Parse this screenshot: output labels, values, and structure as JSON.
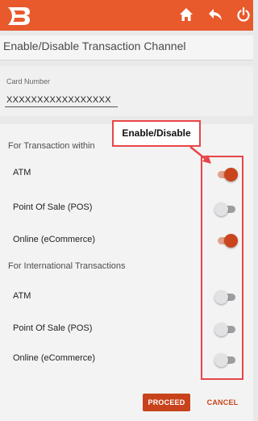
{
  "header": {
    "logo_icon": "bank-of-baroda-logo",
    "icons": [
      "home-icon",
      "back-icon",
      "power-icon"
    ],
    "brand_color": "#e8592c"
  },
  "page": {
    "title": "Enable/Disable Transaction Channel"
  },
  "card": {
    "label": "Card Number",
    "value": "XXXXXXXXXXXXXXXXX"
  },
  "domestic": {
    "title": "For Transaction within",
    "items": [
      {
        "label": "ATM",
        "enabled": true
      },
      {
        "label": "Point Of Sale (POS)",
        "enabled": false
      },
      {
        "label": "Online (eCommerce)",
        "enabled": true
      }
    ]
  },
  "international": {
    "title": "For International Transactions",
    "items": [
      {
        "label": "ATM",
        "enabled": false
      },
      {
        "label": "Point Of Sale (POS)",
        "enabled": false
      },
      {
        "label": "Online (eCommerce)",
        "enabled": false
      }
    ]
  },
  "annotation": {
    "callout_text": "Enable/Disable",
    "color": "#e84548"
  },
  "actions": {
    "proceed_label": "PROCEED",
    "cancel_label": "CANCEL"
  }
}
